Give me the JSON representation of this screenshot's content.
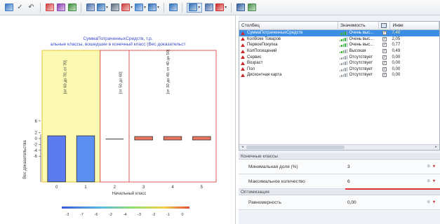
{
  "toolbar": {
    "buttons": [
      {
        "name": "chart-icon",
        "color": "#3a7ac8"
      },
      {
        "name": "check-icon",
        "glyph": "✓"
      },
      {
        "name": "undo-icon",
        "glyph": "↶"
      },
      {
        "name": "filter-icon",
        "color": "#d04545"
      },
      {
        "name": "target-icon",
        "color": "#8a3fb0"
      },
      {
        "name": "network-icon",
        "color": "#3c8d3c"
      },
      {
        "name": "table-icon",
        "color": "#4a6ea8"
      },
      {
        "name": "layout-icon",
        "color": "#2f6fb5"
      },
      {
        "name": "grid-icon",
        "color": "#5b6c80"
      },
      {
        "name": "bar-chart-icon",
        "color": "#cc3b3b"
      },
      {
        "name": "area-chart-icon",
        "color": "#3d7cc9"
      },
      {
        "name": "line-chart-icon",
        "color": "#2d6db8"
      },
      {
        "name": "window-icon",
        "color": "#3170b9"
      },
      {
        "name": "tabs-icon",
        "color": "#2f6fb5"
      },
      {
        "name": "dock-icon",
        "color": "#4a6ea8"
      },
      {
        "name": "marker-icon",
        "color": "#cc2a2a"
      },
      {
        "name": "save-icon",
        "color": "#2f5d9a"
      },
      {
        "name": "settings-icon",
        "color": "#4a8f4a"
      }
    ]
  },
  "chart": {
    "title_line1": "СуммаПотраченныхСредств, т.р.",
    "title_line2": "альные классы, вошедшие в конечный класс (Вес доказательст"
  },
  "chart_data": {
    "type": "bar",
    "categories": [
      "0",
      "1",
      "2",
      "3",
      "4",
      "5"
    ],
    "values": [
      6,
      6,
      0.2,
      -0.5,
      -0.6,
      -0.8
    ],
    "ylabel": "Вес доказательства",
    "xlabel": "Начальный класс",
    "yticks": [
      "6",
      "2",
      "0",
      "-2",
      "-4",
      "-6"
    ],
    "ylim": [
      -8,
      8
    ],
    "bar_colors": [
      "#5b7cf0",
      "#5b8ff2",
      "#6a6a6a",
      "#e8765f",
      "#e8765f",
      "#e8765f"
    ],
    "range_labels": [
      "[от 60 до 70; от 70]",
      "[от 50 до 60]",
      "[от 30 до 40; от 40 до 50]"
    ],
    "colorbar_ticks": [
      "-3",
      "-7",
      "-6",
      "-2",
      "-4",
      "-3",
      "-2",
      "-1",
      "0"
    ],
    "highlight_color": "#fbf9b2",
    "grid": false
  },
  "grid": {
    "columns": [
      "Столбец",
      "Значимость",
      "",
      "Инве"
    ],
    "rows": [
      {
        "name": "СуммаПотраченныхСредств",
        "importance": "Очень выс...",
        "checked": true,
        "value": "7,40",
        "level": 4,
        "selected": true
      },
      {
        "name": "КолВоке Товаров",
        "importance": "Очень выс...",
        "checked": true,
        "value": "2,05",
        "level": 4
      },
      {
        "name": "ПервоеПокупка",
        "importance": "Очень выс...",
        "checked": true,
        "value": "0,77",
        "level": 4
      },
      {
        "name": "КолПосещений",
        "importance": "Высокая",
        "checked": true,
        "value": "0,49",
        "level": 3
      },
      {
        "name": "Сервис",
        "importance": "Отсутствует",
        "checked": true,
        "value": "0,00",
        "level": 0
      },
      {
        "name": "Возраст",
        "importance": "Отсутствует",
        "checked": true,
        "value": "0,00",
        "level": 0
      },
      {
        "name": "Пол",
        "importance": "Отсутствует",
        "checked": true,
        "value": "0,00",
        "level": 0
      },
      {
        "name": "Дисконтная карта",
        "importance": "Отсутствует",
        "checked": true,
        "value": "0,00",
        "level": 0
      }
    ],
    "level_colors": {
      "active": "#39b339",
      "inactive": "#9aa3ad"
    }
  },
  "props": {
    "section1": "Конечные классы",
    "min_share_label": "Минимальная доля (%)",
    "min_share_value": "3",
    "max_count_label": "Максимальное количество",
    "max_count_value": "6",
    "section2": "Оптимизация",
    "uniform_label": "Равномерность",
    "uniform_value": "0,00"
  }
}
